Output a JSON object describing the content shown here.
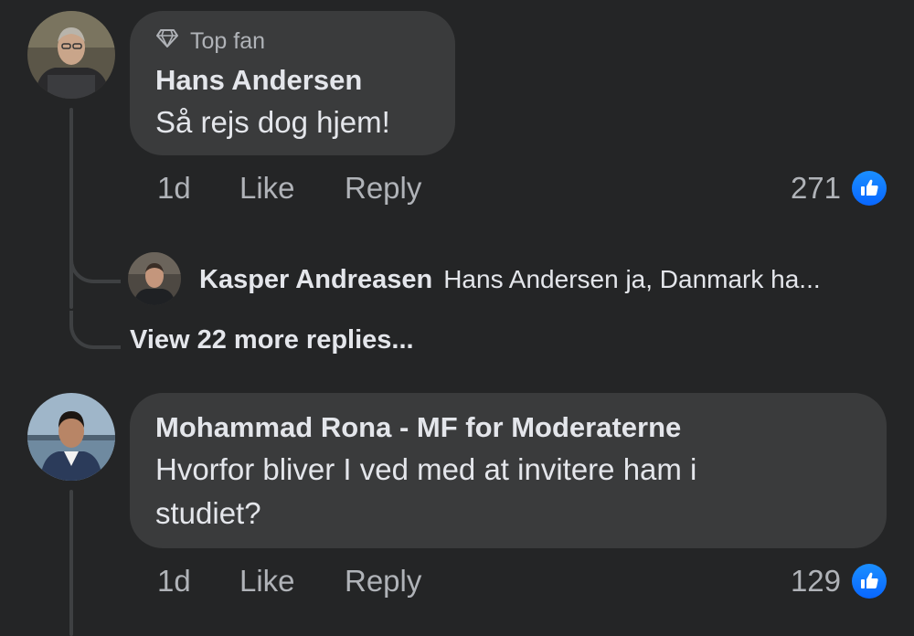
{
  "comments": [
    {
      "badge": "Top fan",
      "badge_icon": "diamond-icon",
      "author": "Hans Andersen",
      "text": "Så rejs dog hjem!",
      "time": "1d",
      "like_label": "Like",
      "reply_label": "Reply",
      "reaction_count": "271",
      "reaction_icon": "like-thumb-icon",
      "reply_preview": {
        "author": "Kasper Andreasen",
        "text": "Hans Andersen ja, Danmark ha..."
      },
      "view_more_label": "View 22 more replies..."
    },
    {
      "author": "Mohammad Rona - MF for Moderaterne",
      "text_line1": "Hvorfor bliver I ved med at invitere ham i",
      "text_line2": "studiet?",
      "time": "1d",
      "like_label": "Like",
      "reply_label": "Reply",
      "reaction_count": "129",
      "reaction_icon": "like-thumb-icon"
    }
  ],
  "colors": {
    "background": "#242526",
    "bubble": "#3a3b3c",
    "primary_text": "#e4e6eb",
    "secondary_text": "#b0b3b8",
    "like_blue": "#0866ff"
  }
}
